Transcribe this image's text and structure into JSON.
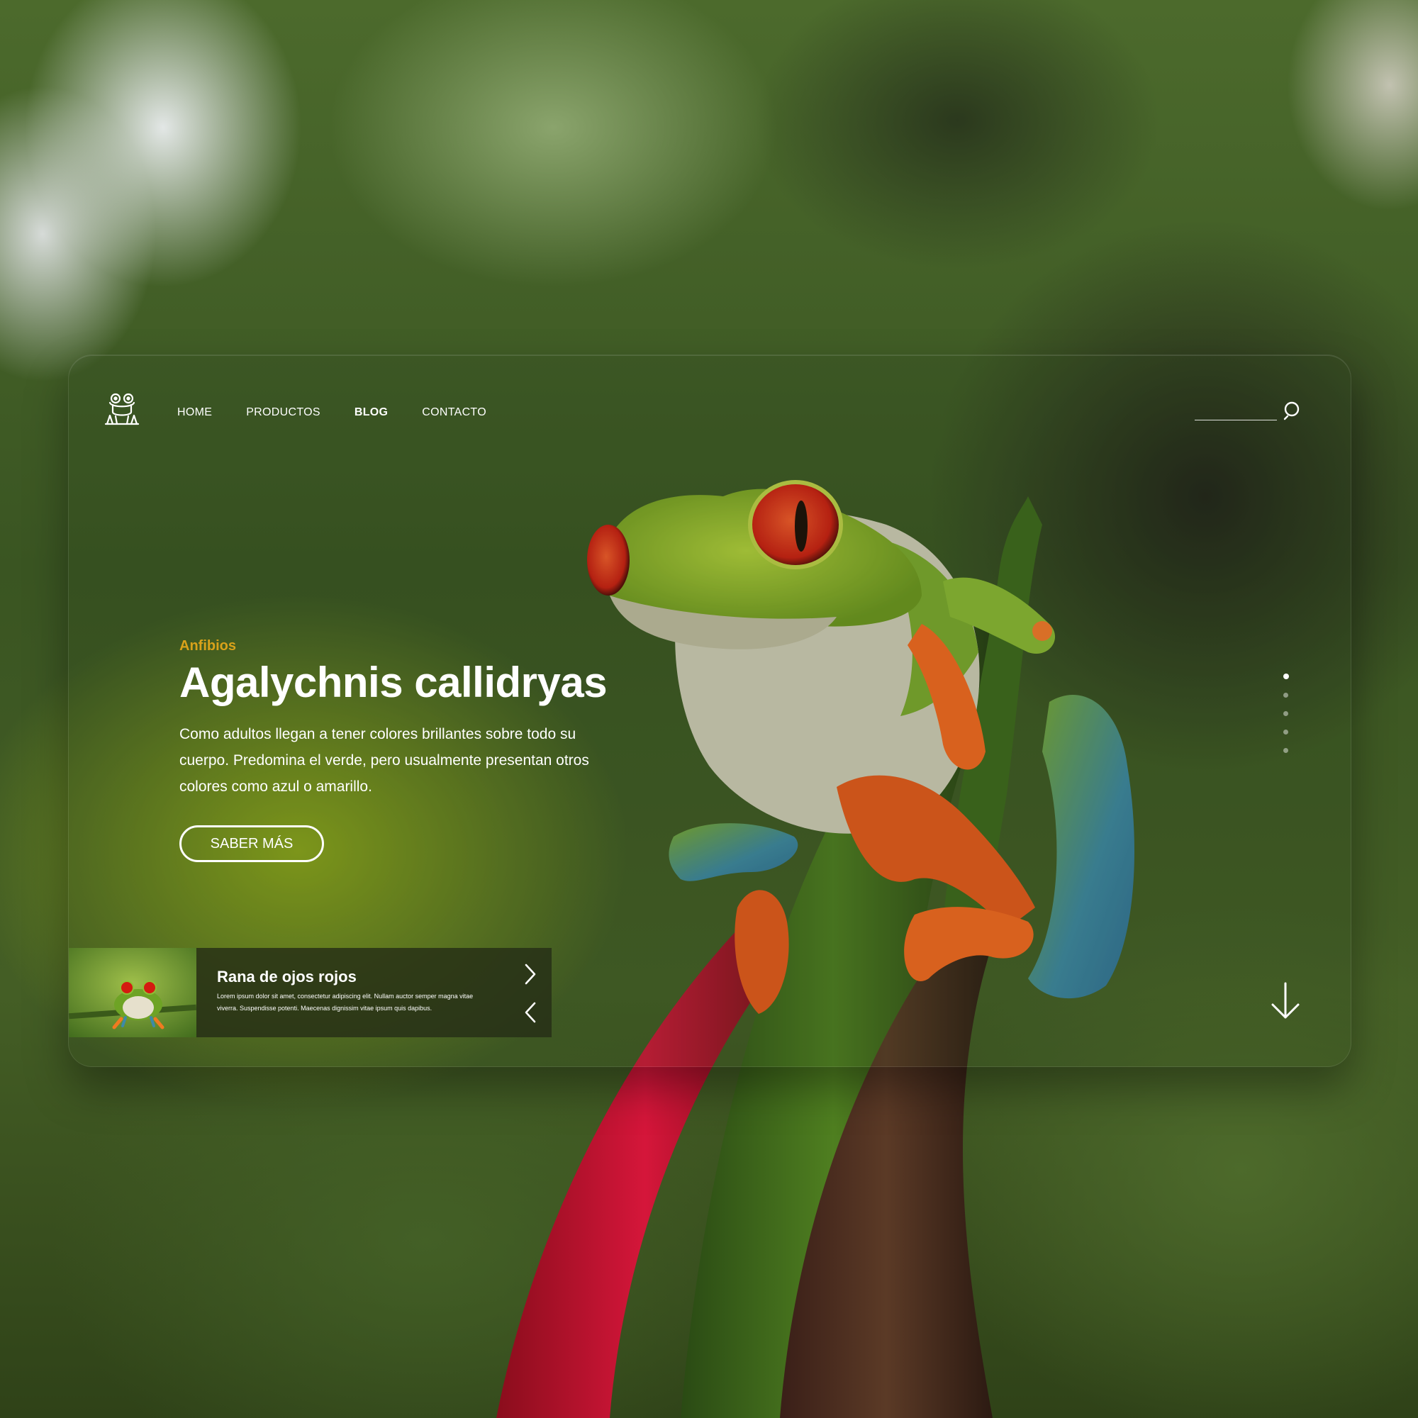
{
  "nav": {
    "items": [
      {
        "label": "HOME",
        "active": false
      },
      {
        "label": "PRODUCTOS",
        "active": false
      },
      {
        "label": "BLOG",
        "active": true
      },
      {
        "label": "CONTACTO",
        "active": false
      }
    ]
  },
  "search": {
    "placeholder": "",
    "icon": "search-icon"
  },
  "hero": {
    "category": "Anfibios",
    "title": "Agalychnis callidryas",
    "description": "Como adultos llegan a tener colores brillantes sobre todo su cuerpo. Predomina el verde, pero usualmente presentan otros colores como azul o amarillo.",
    "cta_label": "SABER MÁS"
  },
  "slider": {
    "dots_count": 5,
    "active_dot": 1
  },
  "slide_card": {
    "title": "Rana de ojos rojos",
    "text": "Lorem ipsum dolor sit amet, consectetur adipiscing elit. Nullam auctor semper magna vitae viverra. Suspendisse potenti. Maecenas dignissim vitae ipsum quis dapibus."
  },
  "colors": {
    "accent": "#d9a21a",
    "text": "#ffffff",
    "card_overlay": "#262e16"
  }
}
